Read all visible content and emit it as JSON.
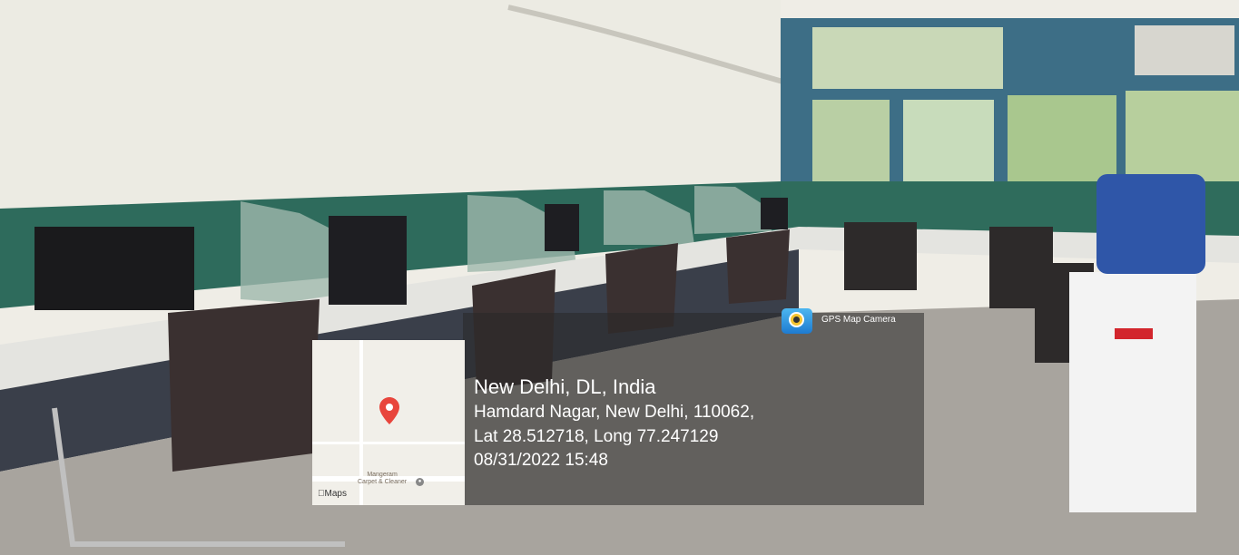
{
  "app": {
    "label": "GPS Map Camera",
    "icon": "gps-map-camera-app-icon"
  },
  "location": {
    "title": "New Delhi, DL, India",
    "address": "Hamdard Nagar, New Delhi, 110062,",
    "coords": "Lat 28.512718, Long 77.247129",
    "datetime": "08/31/2022 15:48"
  },
  "map": {
    "brand": "Maps",
    "poi_label_1": "Mangeram",
    "poi_label_2": "Carpet & Cleaner",
    "pin_icon": "map-pin-icon",
    "pin_color": "#e8453c"
  },
  "colors": {
    "overlay": "#282828",
    "partition_green": "#2e6b5c",
    "wall": "#f0efe8"
  }
}
